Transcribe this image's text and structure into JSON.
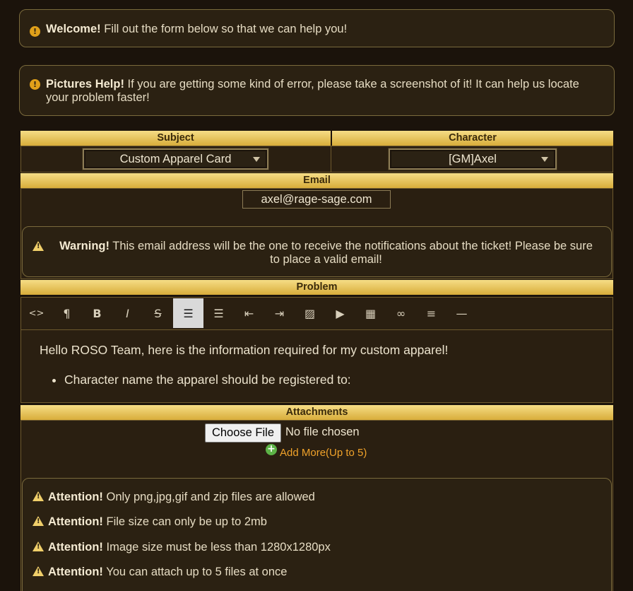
{
  "alerts": {
    "welcome": {
      "title": "Welcome!",
      "text": "Fill out the form below so that we can help you!"
    },
    "pictures": {
      "title": "Pictures Help!",
      "text": "If you are getting some kind of error, please take a screenshot of it! It can help us locate your problem faster!"
    }
  },
  "form": {
    "subject": {
      "label": "Subject",
      "value": "Custom Apparel Card"
    },
    "character": {
      "label": "Character",
      "value": "[GM]Axel"
    },
    "email": {
      "label": "Email",
      "value": "axel@rage-sage.com"
    },
    "email_warning": {
      "title": "Warning!",
      "text": "This email address will be the one to receive the notifications about the ticket! Please be sure to place a valid email!"
    },
    "problem": {
      "label": "Problem",
      "toolbar": [
        {
          "name": "code-view-icon",
          "glyph": "<>"
        },
        {
          "name": "paragraph-icon",
          "glyph": "¶"
        },
        {
          "name": "bold-icon",
          "glyph": "B"
        },
        {
          "name": "italic-icon",
          "glyph": "I"
        },
        {
          "name": "strikethrough-icon",
          "glyph": "S"
        },
        {
          "name": "unordered-list-icon",
          "glyph": "☰",
          "active": true
        },
        {
          "name": "ordered-list-icon",
          "glyph": "☰"
        },
        {
          "name": "outdent-icon",
          "glyph": "⇤"
        },
        {
          "name": "indent-icon",
          "glyph": "⇥"
        },
        {
          "name": "image-icon",
          "glyph": "▨"
        },
        {
          "name": "video-icon",
          "glyph": "▶"
        },
        {
          "name": "table-icon",
          "glyph": "▦"
        },
        {
          "name": "link-icon",
          "glyph": "∞"
        },
        {
          "name": "align-icon",
          "glyph": "≡"
        },
        {
          "name": "horizontal-rule-icon",
          "glyph": "—"
        }
      ],
      "content": {
        "intro": "Hello ROSO Team, here is the information required for my custom apparel!",
        "bullet": "Character name the apparel should be registered to:"
      }
    },
    "attachments": {
      "label": "Attachments",
      "button": "Choose File",
      "status": "No file chosen",
      "add_more": "Add More(Up to 5)",
      "notices": [
        {
          "title": "Attention!",
          "text": "Only png,jpg,gif and zip files are allowed"
        },
        {
          "title": "Attention!",
          "text": "File size can only be up to 2mb"
        },
        {
          "title": "Attention!",
          "text": "Image size must be less than 1280x1280px"
        },
        {
          "title": "Attention!",
          "text": "You can attach up to 5 files at once"
        }
      ]
    }
  }
}
